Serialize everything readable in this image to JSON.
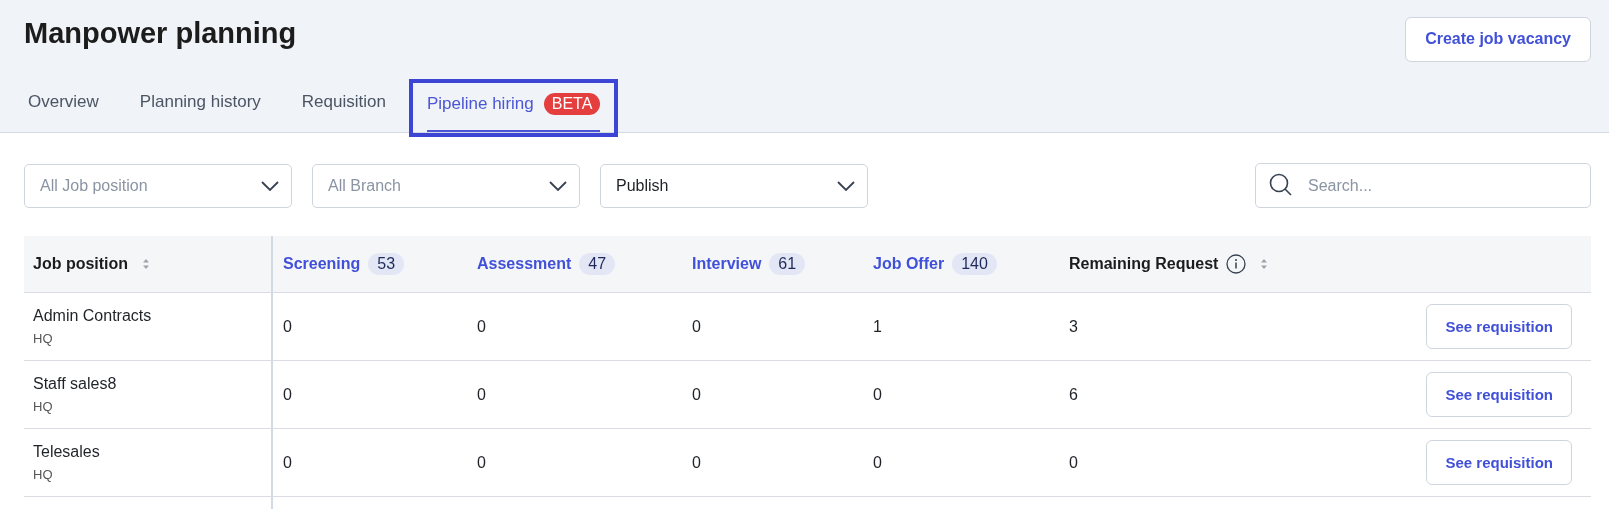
{
  "page_title": "Manpower planning",
  "create_button": "Create job vacancy",
  "tabs": [
    {
      "label": "Overview",
      "selected": false
    },
    {
      "label": "Planning history",
      "selected": false
    },
    {
      "label": "Requisition",
      "selected": false
    },
    {
      "label": "Pipeline hiring",
      "selected": true,
      "badge": "BETA",
      "highlighted": true
    }
  ],
  "filters": [
    {
      "value": "All Job position",
      "placeholder": true
    },
    {
      "value": "All Branch",
      "placeholder": true
    },
    {
      "value": "Publish",
      "placeholder": false
    }
  ],
  "search": {
    "placeholder": "Search..."
  },
  "table": {
    "columns": [
      {
        "label": "Job position",
        "kind": "sort"
      },
      {
        "label": "Screening",
        "kind": "stage",
        "count": "53"
      },
      {
        "label": "Assessment",
        "kind": "stage",
        "count": "47"
      },
      {
        "label": "Interview",
        "kind": "stage",
        "count": "61"
      },
      {
        "label": "Job Offer",
        "kind": "stage",
        "count": "140"
      },
      {
        "label": "Remaining Request",
        "kind": "info-sort"
      }
    ],
    "rows": [
      {
        "position": "Admin Contracts",
        "branch": "HQ",
        "values": [
          "0",
          "0",
          "0",
          "1",
          "3"
        ],
        "action": "See requisition"
      },
      {
        "position": "Staff sales8",
        "branch": "HQ",
        "values": [
          "0",
          "0",
          "0",
          "0",
          "6"
        ],
        "action": "See requisition"
      },
      {
        "position": "Telesales",
        "branch": "HQ",
        "values": [
          "0",
          "0",
          "0",
          "0",
          "0"
        ],
        "action": "See requisition"
      }
    ]
  }
}
